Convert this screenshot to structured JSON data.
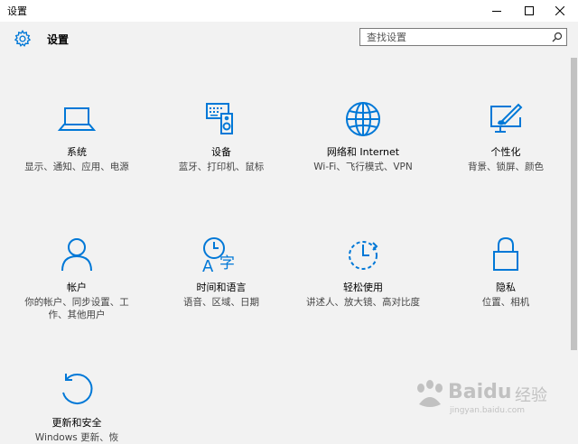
{
  "window": {
    "title": "设置"
  },
  "header": {
    "title": "设置"
  },
  "search": {
    "placeholder": "查找设置"
  },
  "accent_color": "#0078d7",
  "tiles": [
    {
      "icon": "laptop-icon",
      "label": "系统",
      "desc": "显示、通知、应用、电源"
    },
    {
      "icon": "devices-icon",
      "label": "设备",
      "desc": "蓝牙、打印机、鼠标"
    },
    {
      "icon": "globe-icon",
      "label": "网络和 Internet",
      "desc": "Wi-Fi、飞行模式、VPN"
    },
    {
      "icon": "personalization-icon",
      "label": "个性化",
      "desc": "背景、锁屏、颜色"
    },
    {
      "icon": "account-icon",
      "label": "帐户",
      "desc": "你的帐户、同步设置、工作、其他用户"
    },
    {
      "icon": "time-language-icon",
      "label": "时间和语言",
      "desc": "语音、区域、日期"
    },
    {
      "icon": "ease-of-access-icon",
      "label": "轻松使用",
      "desc": "讲述人、放大镜、高对比度"
    },
    {
      "icon": "lock-icon",
      "label": "隐私",
      "desc": "位置、相机"
    },
    {
      "icon": "update-icon",
      "label": "更新和安全",
      "desc": "Windows 更新、恢"
    }
  ],
  "watermark": {
    "brand": "Baidu",
    "cn": "经验",
    "url": "jingyan.baidu.com"
  }
}
